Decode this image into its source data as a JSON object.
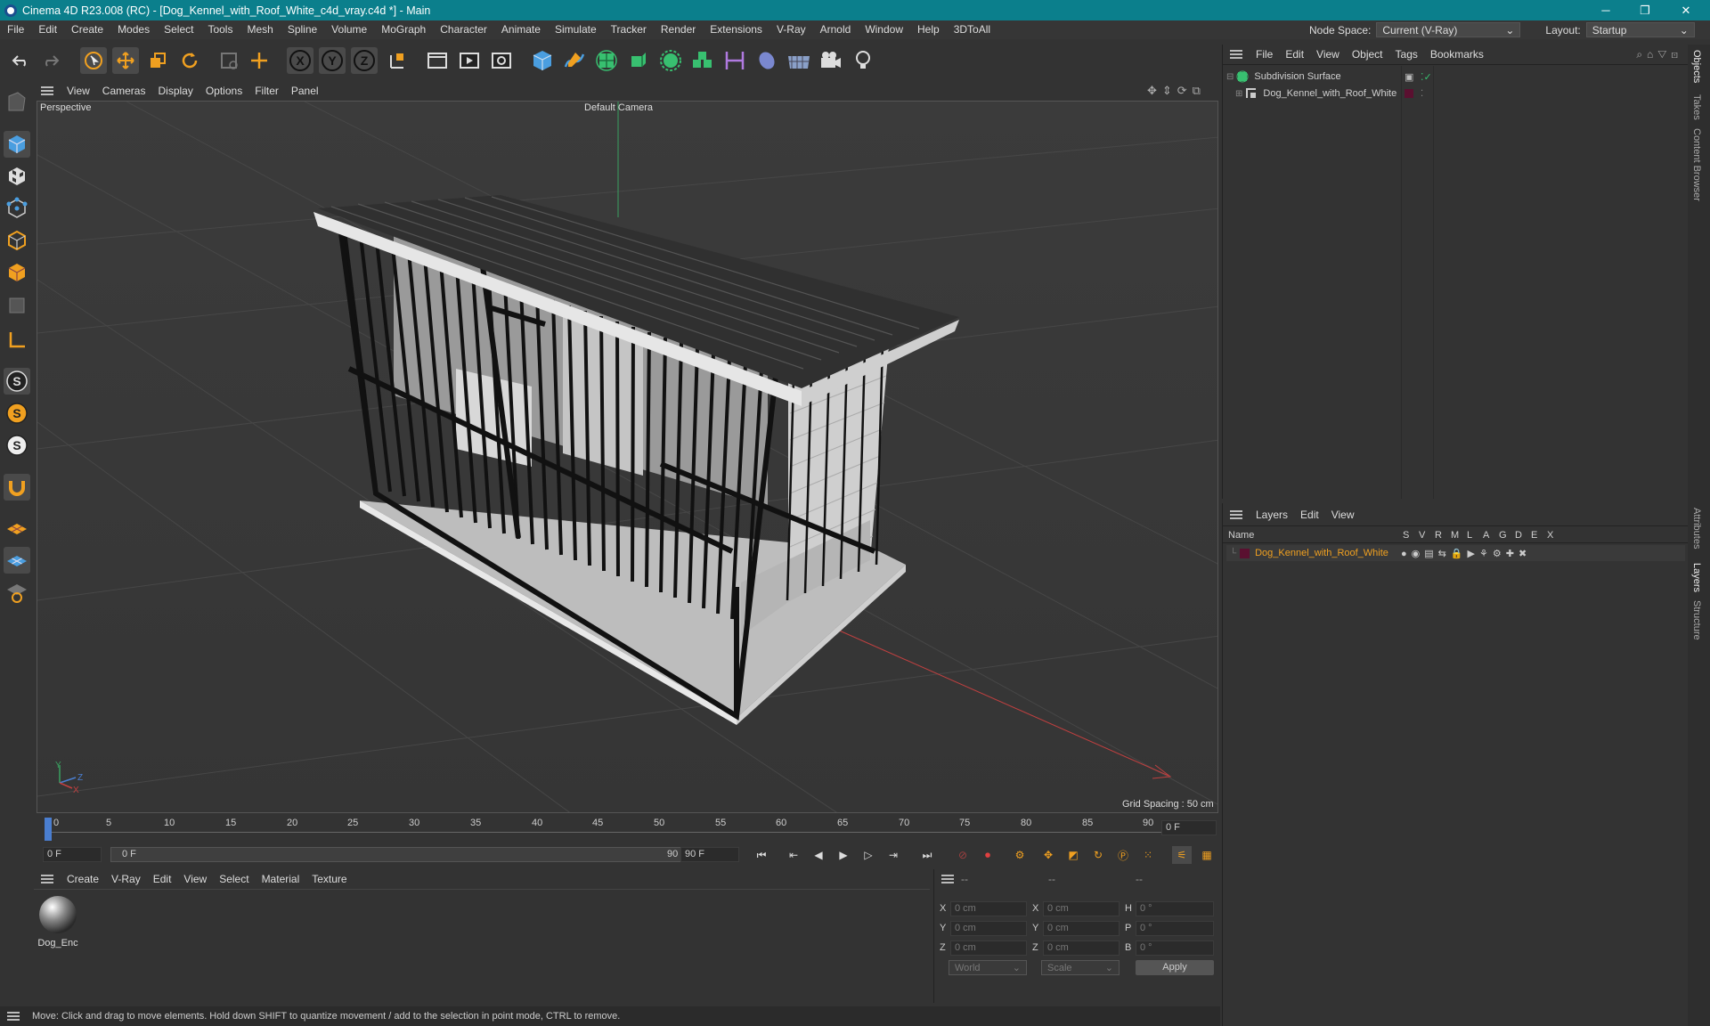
{
  "window": {
    "title": "Cinema 4D R23.008 (RC) - [Dog_Kennel_with_Roof_White_c4d_vray.c4d *] - Main",
    "controls": [
      "─",
      "❐",
      "✕"
    ]
  },
  "menubar": {
    "items": [
      "File",
      "Edit",
      "Create",
      "Modes",
      "Select",
      "Tools",
      "Mesh",
      "Spline",
      "Volume",
      "MoGraph",
      "Character",
      "Animate",
      "Simulate",
      "Tracker",
      "Render",
      "Extensions",
      "V-Ray",
      "Arnold",
      "Window",
      "Help",
      "3DToAll"
    ],
    "node_space_label": "Node Space:",
    "node_space_value": "Current (V-Ray)",
    "layout_label": "Layout:",
    "layout_value": "Startup"
  },
  "viewport": {
    "menu": [
      "View",
      "Cameras",
      "Display",
      "Options",
      "Filter",
      "Panel"
    ],
    "view_name": "Perspective",
    "camera": "Default Camera",
    "grid_spacing": "Grid Spacing : 50 cm",
    "axis_y": "Y",
    "axis_z": "Z",
    "axis_x": "X"
  },
  "timeline": {
    "ticks": [
      "0",
      "5",
      "10",
      "15",
      "20",
      "25",
      "30",
      "35",
      "40",
      "45",
      "50",
      "55",
      "60",
      "65",
      "70",
      "75",
      "80",
      "85",
      "90"
    ],
    "current_frame": "0 F"
  },
  "transport": {
    "start_field": "0 F",
    "range_start": "0 F",
    "range_end": "90 F",
    "end_field": "90 F"
  },
  "materials": {
    "menu": [
      "Create",
      "V-Ray",
      "Edit",
      "View",
      "Select",
      "Material",
      "Texture"
    ],
    "items": [
      {
        "name": "Dog_Enc"
      }
    ]
  },
  "coordinates": {
    "headers": [
      "--",
      "--",
      "--"
    ],
    "rows": [
      {
        "l1": "X",
        "v1": "0 cm",
        "l2": "X",
        "v2": "0 cm",
        "l3": "H",
        "v3": "0 °"
      },
      {
        "l1": "Y",
        "v1": "0 cm",
        "l2": "Y",
        "v2": "0 cm",
        "l3": "P",
        "v3": "0 °"
      },
      {
        "l1": "Z",
        "v1": "0 cm",
        "l2": "Z",
        "v2": "0 cm",
        "l3": "B",
        "v3": "0 °"
      }
    ],
    "mode": "World",
    "transform": "Scale",
    "apply": "Apply"
  },
  "status": "Move: Click and drag to move elements. Hold down SHIFT to quantize movement / add to the selection in point mode, CTRL to remove.",
  "objects": {
    "menu": [
      "File",
      "Edit",
      "View",
      "Object",
      "Tags",
      "Bookmarks"
    ],
    "tree": [
      {
        "name": "Subdivision Surface"
      },
      {
        "name": "Dog_Kennel_with_Roof_White"
      }
    ]
  },
  "layers": {
    "menu": [
      "Layers",
      "Edit",
      "View"
    ],
    "columns": [
      "Name",
      "S",
      "V",
      "R",
      "M",
      "L",
      "A",
      "G",
      "D",
      "E",
      "X"
    ],
    "rows": [
      {
        "name": "Dog_Kennel_with_Roof_White",
        "color": "#8a2a5a"
      }
    ]
  },
  "side_tabs": [
    "Objects",
    "Takes",
    "Content Browser",
    "Attributes",
    "Layers",
    "Structure"
  ]
}
